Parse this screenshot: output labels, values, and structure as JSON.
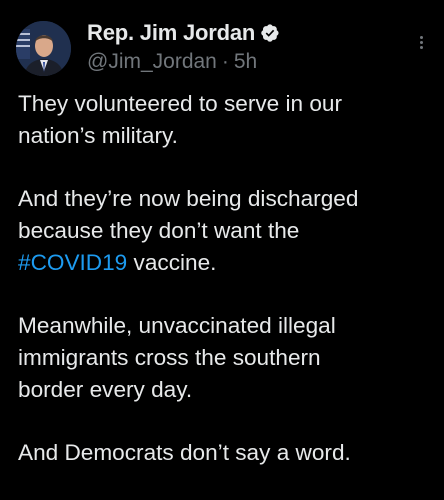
{
  "tweet": {
    "author_name": "Rep. Jim Jordan",
    "handle": "@Jim_Jordan",
    "separator": "·",
    "time": "5h",
    "paragraphs": [
      [
        "They volunteered to serve in our",
        "nation’s military."
      ],
      [
        "And they’re now being discharged",
        "because they don’t want the"
      ],
      [
        "Meanwhile, unvaccinated illegal",
        "immigrants cross the southern",
        "border every day."
      ],
      [
        "And Democrats don’t say a word."
      ]
    ],
    "hashtag": "#COVID19",
    "hashtag_suffix": " vaccine."
  },
  "icons": {
    "verified": "verified-badge-icon",
    "more": "more-vertical-icon"
  },
  "colors": {
    "background": "#000000",
    "text": "#e7e9ea",
    "muted": "#71767b",
    "link": "#1d9bf0"
  }
}
